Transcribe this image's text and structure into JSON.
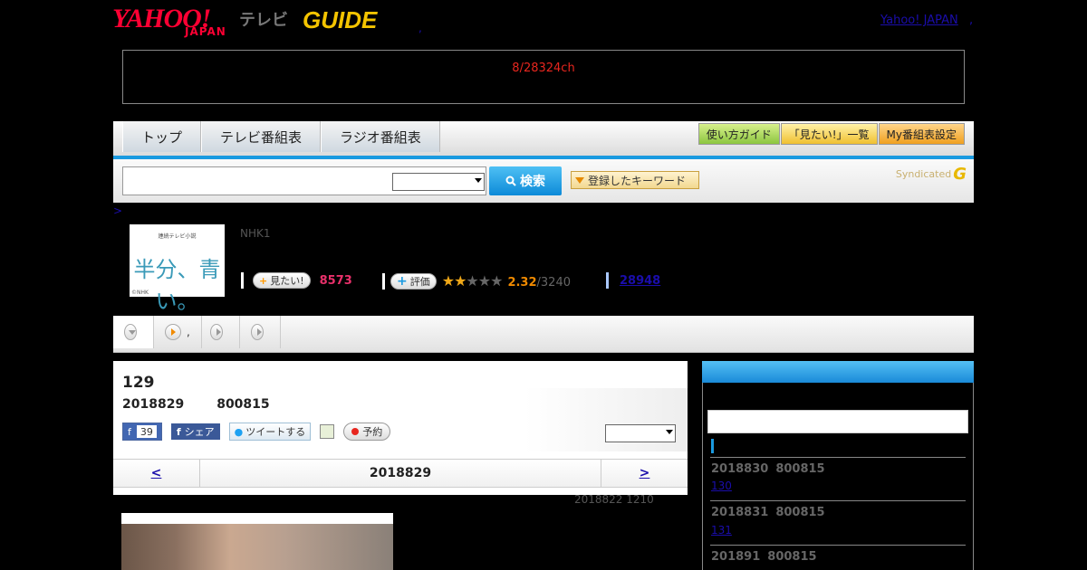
{
  "header": {
    "yahoo_logo": "YAHOO!",
    "japan_logo": "JAPAN",
    "tv_label": "テレビ",
    "gguide_logo": "GUIDE",
    "dot": ",",
    "yahoo_japan_link": "Yahoo! JAPAN",
    "link_comma": ","
  },
  "alert": {
    "text": "8/28324ch"
  },
  "nav": {
    "tabs": [
      {
        "label": "トップ"
      },
      {
        "label": "テレビ番組表"
      },
      {
        "label": "ラジオ番組表"
      }
    ],
    "guide_btn": "使い方ガイド",
    "wishlist_btn": "「見たい!」一覧",
    "my_settings_btn": "My番組表設定"
  },
  "search": {
    "input_value": "",
    "select_value": "",
    "button_label": "検索",
    "keyword_btn": "登録したキーワード",
    "syndicated": "Syndicated",
    "syndicated_logo": "G"
  },
  "breadcrumb": ">",
  "program": {
    "thumb_top": "連続テレビ小説",
    "thumb_title": "半分、青い。",
    "thumb_credit": "©NHK",
    "channel": "NHK1",
    "mitai_label": "見たい!",
    "mitai_count": "8573",
    "rating_label": "評価",
    "rating_value": "2.32",
    "rating_total": "/3240",
    "rating_stars": 2,
    "favorites": "28948"
  },
  "tabs": [
    {
      "label": ""
    },
    {
      "label": ","
    },
    {
      "label": ""
    },
    {
      "label": ""
    }
  ],
  "episode": {
    "number": "129",
    "date": "2018829",
    "time": "800815",
    "fb_like": "39",
    "fb_share": "シェア",
    "tweet": "ツイートする",
    "reserve": "予約",
    "select_value": "",
    "prev": "<",
    "current": "2018829",
    "next": ">",
    "updated": "2018822  1210"
  },
  "sidebar": {
    "items": [
      {
        "date": "2018830",
        "time": "800815",
        "link": "130"
      },
      {
        "date": "2018831",
        "time": "800815",
        "link": "131"
      },
      {
        "date": "201891",
        "time": "800815",
        "link": ""
      }
    ]
  },
  "colors": {
    "accent_blue": "#1a9ae0",
    "link": "#1a0dab",
    "alert_red": "#e8261e",
    "yahoo_red": "#ff0033",
    "pink_count": "#e8306a",
    "star_orange": "#f0a818"
  }
}
